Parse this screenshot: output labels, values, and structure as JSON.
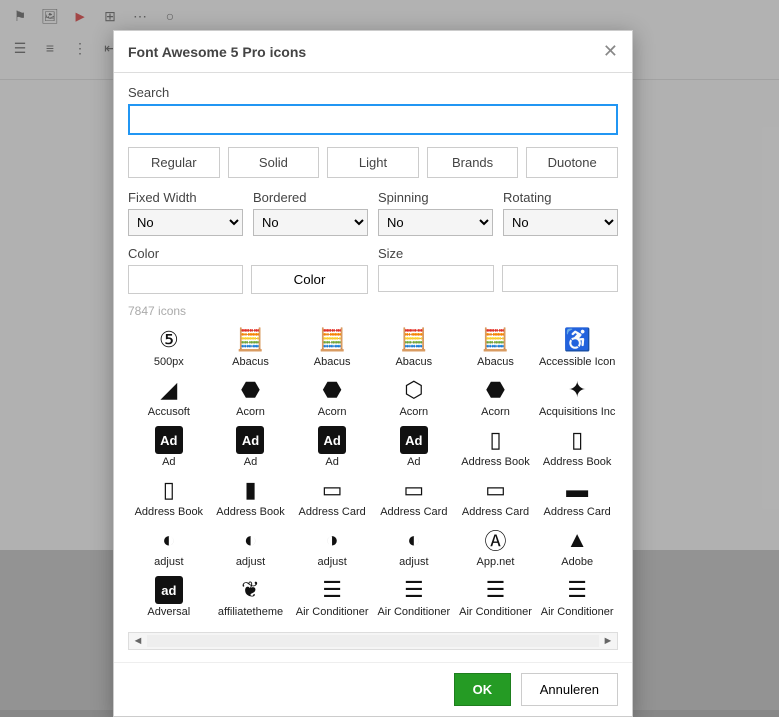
{
  "toolbar": {
    "icons": [
      "flag-icon",
      "image-icon",
      "youtube-icon",
      "table-icon",
      "code-icon",
      "help-icon"
    ],
    "icons2": [
      "list-ol-icon",
      "list-ul-icon",
      "outdent-icon",
      "indent-icon"
    ]
  },
  "dialog": {
    "title": "Font Awesome 5 Pro icons",
    "search_label": "Search",
    "search_value": "",
    "styles": [
      "Regular",
      "Solid",
      "Light",
      "Brands",
      "Duotone"
    ],
    "options": [
      {
        "label": "Fixed Width",
        "value": "No"
      },
      {
        "label": "Bordered",
        "value": "No"
      },
      {
        "label": "Spinning",
        "value": "No"
      },
      {
        "label": "Rotating",
        "value": "No"
      }
    ],
    "color_label": "Color",
    "color_btn": "Color",
    "size_label": "Size",
    "count": "7847 icons",
    "icons": [
      {
        "name": "500px",
        "g": "⑤"
      },
      {
        "name": "Abacus",
        "g": "🧮"
      },
      {
        "name": "Abacus",
        "g": "🧮"
      },
      {
        "name": "Abacus",
        "g": "🧮"
      },
      {
        "name": "Abacus",
        "g": "🧮"
      },
      {
        "name": "Accessible Icon",
        "g": "♿"
      },
      {
        "name": "Accusoft",
        "g": "◢"
      },
      {
        "name": "Acorn",
        "g": "⬣"
      },
      {
        "name": "Acorn",
        "g": "⬣"
      },
      {
        "name": "Acorn",
        "g": "⬡"
      },
      {
        "name": "Acorn",
        "g": "⬣"
      },
      {
        "name": "Acquisitions Inc",
        "g": "✦"
      },
      {
        "name": "Ad",
        "g": "Ad"
      },
      {
        "name": "Ad",
        "g": "Ad"
      },
      {
        "name": "Ad",
        "g": "Ad"
      },
      {
        "name": "Ad",
        "g": "Ad"
      },
      {
        "name": "Address Book",
        "g": "▯"
      },
      {
        "name": "Address Book",
        "g": "▯"
      },
      {
        "name": "Address Book",
        "g": "▯"
      },
      {
        "name": "Address Book",
        "g": "▮"
      },
      {
        "name": "Address Card",
        "g": "▭"
      },
      {
        "name": "Address Card",
        "g": "▭"
      },
      {
        "name": "Address Card",
        "g": "▭"
      },
      {
        "name": "Address Card",
        "g": "▬"
      },
      {
        "name": "adjust",
        "g": "◐"
      },
      {
        "name": "adjust",
        "g": "◐"
      },
      {
        "name": "adjust",
        "g": "◑"
      },
      {
        "name": "adjust",
        "g": "◐"
      },
      {
        "name": "App.net",
        "g": "Ⓐ"
      },
      {
        "name": "Adobe",
        "g": "▲"
      },
      {
        "name": "Adversal",
        "g": "ad"
      },
      {
        "name": "affiliatetheme",
        "g": "❦"
      },
      {
        "name": "Air Conditioner",
        "g": "☰"
      },
      {
        "name": "Air Conditioner",
        "g": "☰"
      },
      {
        "name": "Air Conditioner",
        "g": "☰"
      },
      {
        "name": "Air Conditioner",
        "g": "☰"
      }
    ],
    "ok": "OK",
    "cancel": "Annuleren"
  }
}
